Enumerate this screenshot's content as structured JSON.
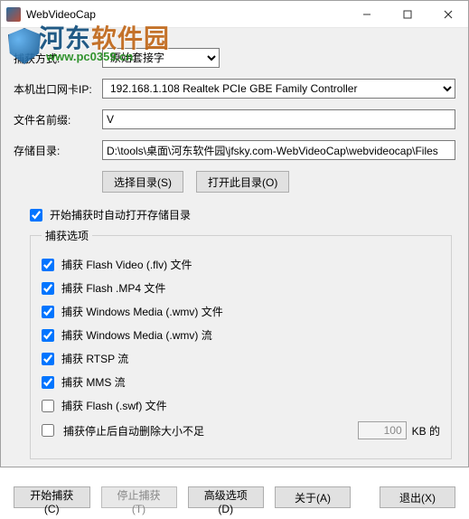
{
  "title": "WebVideoCap",
  "watermark": {
    "cn_part1": "河东",
    "cn_part2": "软件园",
    "url": "www.pc0359.cn"
  },
  "form": {
    "method_label": "捕获方式:",
    "method_value": "原始套接字",
    "nic_label": "本机出口网卡IP:",
    "nic_value": "192.168.1.108   Realtek PCIe GBE Family Controller",
    "prefix_label": "文件名前缀:",
    "prefix_value": "V",
    "folder_label": "存储目录:",
    "folder_value": "D:\\tools\\桌面\\河东软件园\\jfsky.com-WebVideoCap\\webvideocap\\Files",
    "btn_choose": "选择目录(S)",
    "btn_open": "打开此目录(O)",
    "auto_open_label": "开始捕获时自动打开存储目录"
  },
  "capture": {
    "legend": "捕获选项",
    "flv": "捕获 Flash Video (.flv) 文件",
    "mp4": "捕获 Flash .MP4 文件",
    "wmv_file": "捕获 Windows Media (.wmv) 文件",
    "wmv_stream": "捕获 Windows Media (.wmv) 流",
    "rtsp": "捕获 RTSP 流",
    "mms": "捕获 MMS 流",
    "swf": "捕获 Flash (.swf) 文件",
    "auto_del": "捕获停止后自动删除大小不足",
    "kb_value": "100",
    "kb_suffix": "KB 的"
  },
  "buttons": {
    "start": "开始捕获(C)",
    "stop": "停止捕获(T)",
    "advanced": "高级选项(D)",
    "about": "关于(A)",
    "exit": "退出(X)"
  }
}
